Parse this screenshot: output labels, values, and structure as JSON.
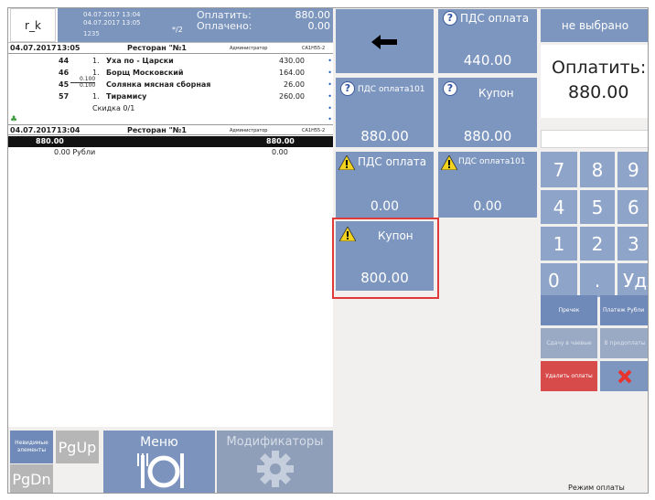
{
  "header": {
    "user": "r_k",
    "date_line1": "04.07.2017 13:04",
    "date_line2": "04.07.2017 13:05",
    "sub_number": "1235",
    "fraction": "*/2",
    "pay_label": "Оплатить:",
    "paid_label": "Оплачено:",
    "pay_value": "880.00",
    "paid_value": "0.00"
  },
  "order": {
    "header1": {
      "date": "04.07.2017",
      "time": "13:05",
      "restaurant": "Ресторан \"№1",
      "role": "Администратор",
      "code": "CA1H55-2"
    },
    "items": [
      {
        "id": "44",
        "qty": "1.",
        "name": "Уха по - Царски",
        "price": "430.00"
      },
      {
        "id": "46",
        "qty": "1.",
        "name": "Борщ Московский",
        "price": "164.00"
      },
      {
        "id": "45",
        "qty_top": "0.100",
        "qty_bottom": "0.100",
        "name": "Солянка мясная сборная",
        "price": "26.00"
      },
      {
        "id": "57",
        "qty": "1.",
        "name": "Тирамису",
        "price": "260.00"
      }
    ],
    "discount": "Скидка 0/1",
    "header2": {
      "date": "04.07.2017",
      "time": "13:04",
      "restaurant": "Ресторан \"№1",
      "role": "Администратор",
      "code": "CA1H55-2"
    },
    "total_left": "880.00",
    "total_right": "880.00",
    "paid_line_left": "0.00 Рубли",
    "paid_line_right": "0.00"
  },
  "bottom": {
    "hidden_elements": "Невидимые элементы",
    "pgup": "PgUp",
    "pgdn": "PgDn",
    "menu": "Меню",
    "modifiers": "Модификаторы"
  },
  "tiles": {
    "back_icon": "arrow-left-icon",
    "pds_oplata": "ПДС оплата",
    "pds_oplata_value": "440.00",
    "pds_oplata101": "ПДС оплата101",
    "pds_oplata101_value": "880.00",
    "kupon": "Купон",
    "kupon_value": "880.00",
    "w_pds_oplata": "ПДС оплата",
    "w_pds_oplata_value": "0.00",
    "w_pds_oplata101": "ПДС оплата101",
    "w_pds_oplata101_value": "0.00",
    "w_kupon": "Купон",
    "w_kupon_value": "800.00"
  },
  "payment": {
    "not_selected": "не выбрано",
    "to_pay_label": "Оплатить:",
    "to_pay_value": "880.00",
    "keys": [
      "7",
      "8",
      "9",
      "4",
      "5",
      "6",
      "1",
      "2",
      "3",
      "0",
      ".",
      "Удл"
    ],
    "btn_check": "Пречек",
    "btn_payment_rub": "Платеж Рубли",
    "btn_change": "Сдачу в чаевые",
    "btn_prepay": "В предоплаты",
    "btn_delete": "Удалить оплаты",
    "mode": "Режим оплаты"
  },
  "colors": {
    "tile": "#7d96bf",
    "highlight": "#e03a3a",
    "delete": "#d84b4b"
  }
}
